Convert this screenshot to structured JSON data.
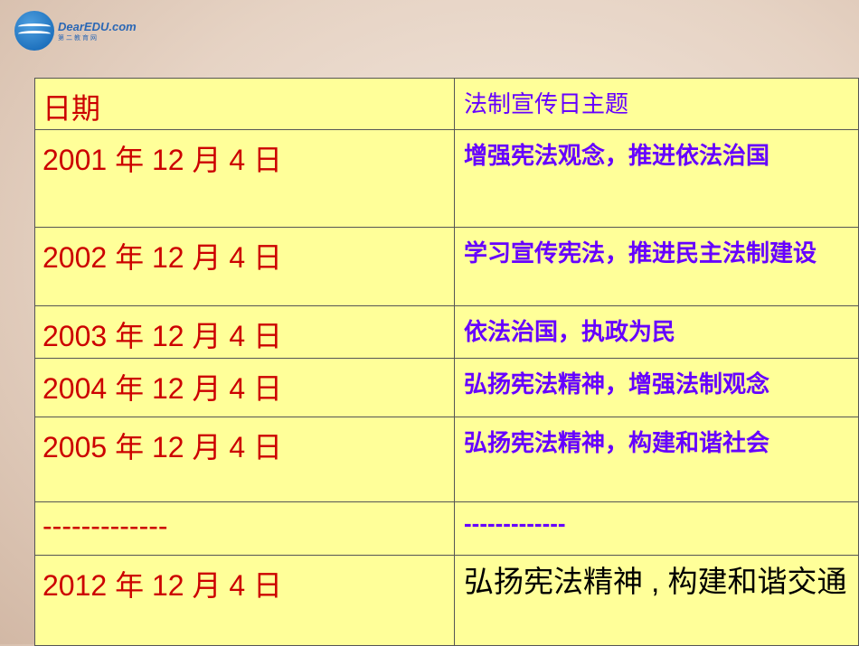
{
  "logo": {
    "name": "DearEDU.com",
    "subtitle": "第二教育网"
  },
  "table": {
    "headers": [
      "日期",
      "法制宣传日主题"
    ],
    "rows": [
      {
        "date": "2001 年 12 月 4 日",
        "theme": "增强宪法观念，推进依法治国"
      },
      {
        "date": "2002 年 12 月 4 日",
        "theme": "学习宣传宪法，推进民主法制建设"
      },
      {
        "date": "2003 年 12 月 4 日",
        "theme": "依法治国，执政为民"
      },
      {
        "date": "2004 年 12 月 4 日",
        "theme": "弘扬宪法精神，增强法制观念"
      },
      {
        "date": "2005 年 12 月 4 日",
        "theme": "弘扬宪法精神，构建和谐社会"
      },
      {
        "date": "-------------",
        "theme": "-------------"
      },
      {
        "date": "2012 年 12 月 4 日",
        "theme": "弘扬宪法精神 , 构建和谐交通"
      }
    ]
  }
}
